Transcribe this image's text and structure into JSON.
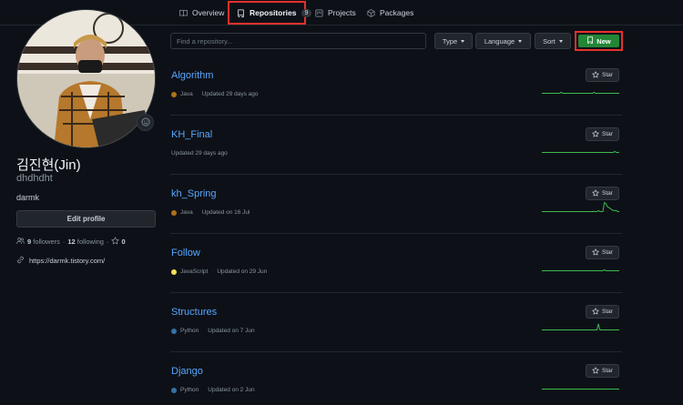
{
  "tabs": {
    "overview": "Overview",
    "repositories": "Repositories",
    "repositories_count": "9",
    "projects": "Projects",
    "packages": "Packages"
  },
  "profile": {
    "fullname": "김진현(Jin)",
    "login": "dhdhdht",
    "bio": "darmk",
    "edit_label": "Edit profile",
    "followers_count": "9",
    "followers_label": "followers",
    "separator": "·",
    "following_count": "12",
    "following_label": "following",
    "stars_separator": "·",
    "stars_count": "0",
    "blog": "https://darmk.tistory.com/"
  },
  "filters": {
    "search_placeholder": "Find a repository...",
    "type_label": "Type",
    "language_label": "Language",
    "sort_label": "Sort",
    "new_label": "New"
  },
  "repos": [
    {
      "name": "Algorithm",
      "language": "Java",
      "language_color": "#b07219",
      "updated": "Updated 29 days ago",
      "star_label": "Star",
      "spark": [
        0,
        0,
        0,
        0,
        0,
        0,
        0,
        0,
        0,
        0,
        0,
        0,
        0,
        1,
        0,
        0,
        0,
        0,
        0,
        0,
        0,
        0,
        0,
        0,
        0,
        0,
        0,
        0,
        0,
        0,
        0,
        0,
        0,
        0,
        0,
        1,
        0,
        0,
        0,
        0,
        0,
        0,
        0,
        0,
        0,
        0,
        0,
        0,
        0,
        0,
        0,
        0,
        0
      ]
    },
    {
      "name": "KH_Final",
      "language": "",
      "language_color": "",
      "updated": "Updated 29 days ago",
      "star_label": "Star",
      "spark": [
        0,
        0,
        0,
        0,
        0,
        0,
        0,
        0,
        0,
        0,
        0,
        0,
        0,
        0,
        0,
        0,
        0,
        0,
        0,
        0,
        0,
        0,
        0,
        0,
        0,
        0,
        0,
        0,
        0,
        0,
        0,
        0,
        0,
        0,
        0,
        0,
        0,
        0,
        0,
        0,
        0,
        0,
        0,
        0,
        0,
        0,
        0,
        0,
        0,
        1,
        0,
        0,
        0
      ]
    },
    {
      "name": "kh_Spring",
      "language": "Java",
      "language_color": "#b07219",
      "updated": "Updated on 16 Jul",
      "star_label": "Star",
      "spark": [
        0,
        0,
        0,
        0,
        0,
        0,
        0,
        0,
        0,
        0,
        0,
        0,
        0,
        0,
        0,
        0,
        0,
        0,
        0,
        0,
        0,
        0,
        0,
        0,
        0,
        0,
        0,
        0,
        0,
        0,
        0,
        0,
        0,
        0,
        0,
        0,
        0,
        0,
        1,
        0,
        0,
        0,
        9,
        8,
        5,
        4,
        3,
        2,
        1,
        1,
        1,
        0,
        0
      ]
    },
    {
      "name": "Follow",
      "language": "JavaScript",
      "language_color": "#f1e05a",
      "updated": "Updated on 29 Jun",
      "star_label": "Star",
      "spark": [
        0,
        0,
        0,
        0,
        0,
        0,
        0,
        0,
        0,
        0,
        0,
        0,
        0,
        0,
        0,
        0,
        0,
        0,
        0,
        0,
        0,
        0,
        0,
        0,
        0,
        0,
        0,
        0,
        0,
        0,
        0,
        0,
        0,
        0,
        0,
        0,
        0,
        0,
        0,
        0,
        0,
        0,
        1,
        0,
        0,
        0,
        0,
        0,
        0,
        0,
        0,
        0,
        0
      ]
    },
    {
      "name": "Structures",
      "language": "Python",
      "language_color": "#3572a5",
      "updated": "Updated on 7 Jun",
      "star_label": "Star",
      "spark": [
        0,
        0,
        0,
        0,
        0,
        0,
        0,
        0,
        0,
        0,
        0,
        0,
        0,
        0,
        0,
        0,
        0,
        0,
        0,
        0,
        0,
        0,
        0,
        0,
        0,
        0,
        0,
        0,
        0,
        0,
        0,
        0,
        0,
        0,
        0,
        0,
        0,
        0,
        6,
        0,
        0,
        0,
        0,
        0,
        0,
        0,
        0,
        0,
        0,
        0,
        0,
        0,
        0
      ]
    },
    {
      "name": "Django",
      "language": "Python",
      "language_color": "#3572a5",
      "updated": "Updated on 2 Jun",
      "star_label": "Star",
      "spark": [
        0,
        0,
        0,
        0,
        0,
        0,
        0,
        0,
        0,
        0,
        0,
        0,
        0,
        0,
        0,
        0,
        0,
        0,
        0,
        0,
        0,
        0,
        0,
        0,
        0,
        0,
        0,
        0,
        0,
        0,
        0,
        0,
        0,
        0,
        0,
        0,
        0,
        0,
        0,
        0,
        0,
        0,
        0,
        0,
        0,
        0,
        0,
        0,
        0,
        0,
        0,
        0,
        0
      ]
    }
  ],
  "colors": {
    "accent_link": "#58a6ff",
    "new_button": "#238636",
    "highlight_box": "#e5312b",
    "sparkline": "#3fb950"
  }
}
